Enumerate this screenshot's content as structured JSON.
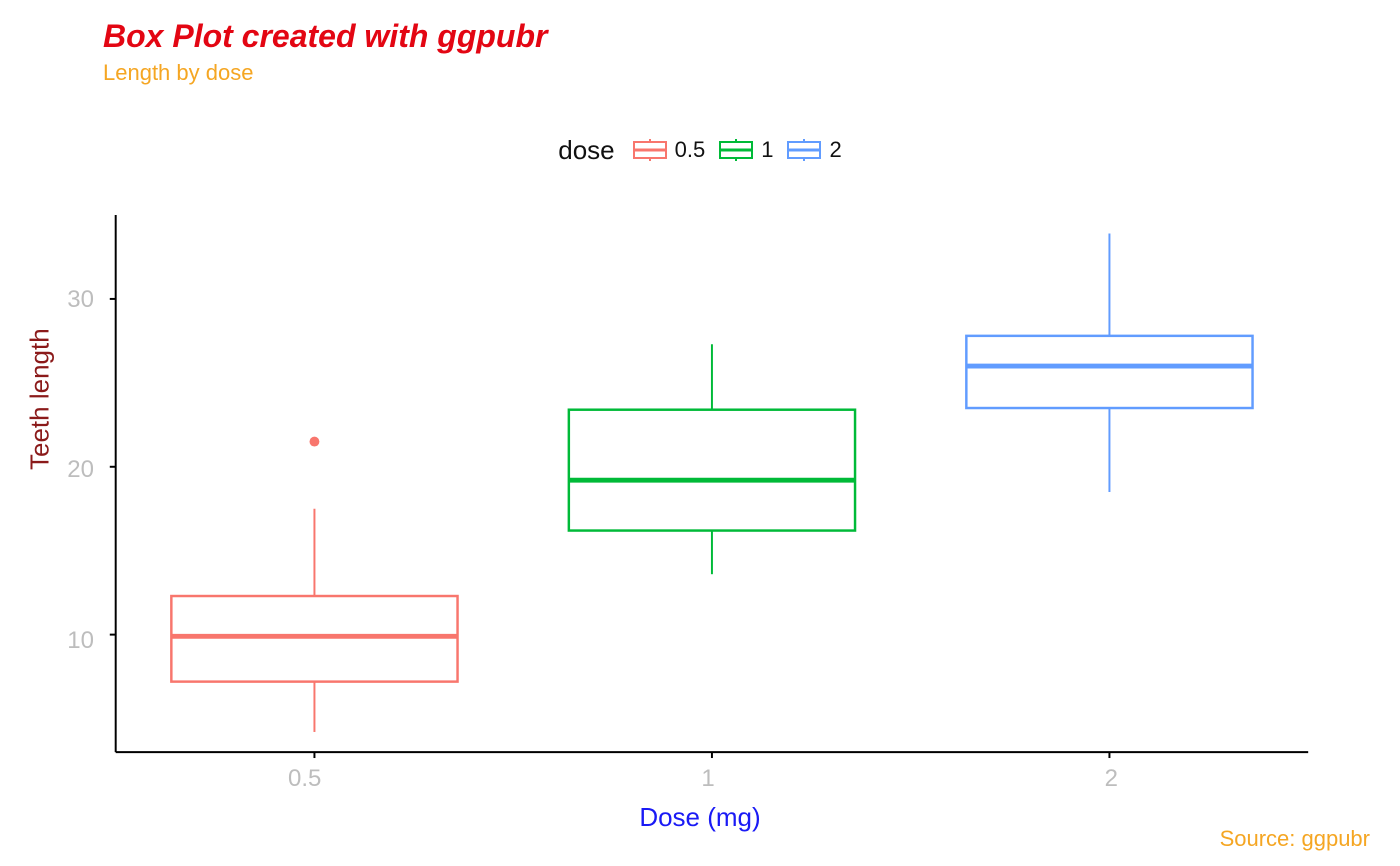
{
  "title": "Box Plot created with ggpubr",
  "subtitle": "Length by dose",
  "caption": "Source: ggpubr",
  "legend_title": "dose",
  "legend_items": [
    "0.5",
    "1",
    "2"
  ],
  "ylab": "Teeth length",
  "xlab": "Dose (mg)",
  "y_ticks": [
    "10",
    "20",
    "30"
  ],
  "x_ticks": [
    "0.5",
    "1",
    "2"
  ],
  "colors": {
    "dose_0_5": "#f8766d",
    "dose_1": "#00ba38",
    "dose_2": "#619cff",
    "axis": "#000000",
    "tick": "#bdbdbd",
    "title": "#e30613",
    "subtitle": "#f5a623",
    "ylab": "#8b1a1a",
    "xlab": "#1a1af5"
  },
  "chart_data": {
    "type": "box",
    "xlabel": "Dose (mg)",
    "ylabel": "Teeth length",
    "title": "Box Plot created with ggpubr",
    "categories": [
      "0.5",
      "1",
      "2"
    ],
    "ylim": [
      3,
      35
    ],
    "y_ticks": [
      10,
      20,
      30
    ],
    "series": [
      {
        "name": "0.5",
        "color": "#f8766d",
        "min": 4.2,
        "q1": 7.2,
        "median": 9.9,
        "q3": 12.3,
        "max": 17.5,
        "outliers": [
          21.5
        ]
      },
      {
        "name": "1",
        "color": "#00ba38",
        "min": 13.6,
        "q1": 16.2,
        "median": 19.2,
        "q3": 23.4,
        "max": 27.3,
        "outliers": []
      },
      {
        "name": "2",
        "color": "#619cff",
        "min": 18.5,
        "q1": 23.5,
        "median": 26.0,
        "q3": 27.8,
        "max": 33.9,
        "outliers": []
      }
    ]
  }
}
